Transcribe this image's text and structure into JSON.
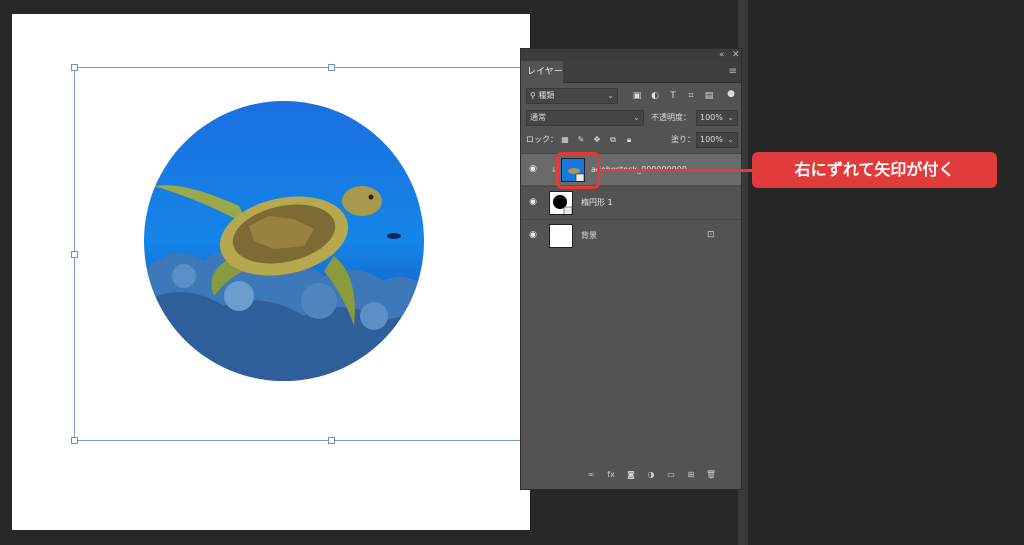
{
  "layers_panel": {
    "tab_label": "レイヤー",
    "collapse_icon": "double-chevron-icon",
    "close_icon": "close-icon",
    "menu_icon": "hamburger-menu-icon",
    "filter_kind": "種類",
    "blend_mode": "通常",
    "opacity_label": "不透明度：",
    "opacity_value": "100%",
    "lock_label": "ロック：",
    "fill_label": "塗り：",
    "fill_value": "100%",
    "layers": [
      {
        "name": "adobestock_000000000",
        "visible": true,
        "selected": true,
        "clipped": true
      },
      {
        "name": "楕円形 1",
        "visible": true,
        "selected": false
      },
      {
        "name": "背景",
        "visible": true,
        "selected": false,
        "locked": true
      }
    ]
  },
  "annotation": {
    "callout_text": "右にずれて矢印が付く",
    "color": "#e23b3b"
  },
  "colors": {
    "panel_bg": "#535353",
    "selected_row": "#6a6a6a",
    "transform_handle": "#7a9bd6"
  }
}
